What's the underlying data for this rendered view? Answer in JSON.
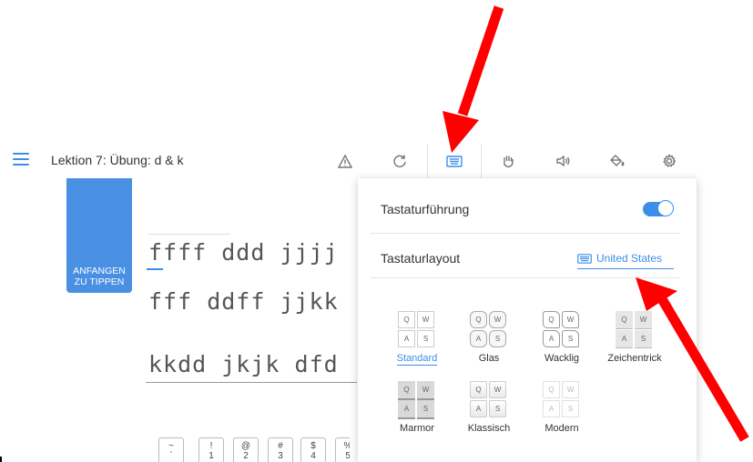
{
  "header": {
    "lesson_title": "Lektion 7: Übung: d & k",
    "tools": [
      {
        "name": "warning-icon"
      },
      {
        "name": "restart-icon"
      },
      {
        "name": "keyboard-icon"
      },
      {
        "name": "hand-icon"
      },
      {
        "name": "sound-icon"
      },
      {
        "name": "paint-bucket-icon"
      },
      {
        "name": "gear-icon"
      }
    ]
  },
  "start_button": {
    "label_line1": "ANFANGEN",
    "label_line2": "ZU TIPPEN"
  },
  "typing": {
    "line1": "ffff ddd jjjj",
    "line2": "fff ddff jjkk",
    "line3": "kkdd jkjk dfd"
  },
  "keyboard": {
    "keys": [
      {
        "top": "~",
        "bottom": "`"
      },
      {
        "top": "!",
        "bottom": "1"
      },
      {
        "top": "@",
        "bottom": "2"
      },
      {
        "top": "#",
        "bottom": "3"
      },
      {
        "top": "$",
        "bottom": "4"
      },
      {
        "top": "%",
        "bottom": "5"
      }
    ]
  },
  "panel": {
    "guidance_label": "Tastaturführung",
    "guidance_enabled": true,
    "layout_label": "Tastaturlayout",
    "layout_value": "United States",
    "styles": [
      {
        "label": "Standard",
        "selected": true
      },
      {
        "label": "Glas",
        "selected": false
      },
      {
        "label": "Wacklig",
        "selected": false
      },
      {
        "label": "Zeichentrick",
        "selected": false
      },
      {
        "label": "Marmor",
        "selected": false
      },
      {
        "label": "Klassisch",
        "selected": false
      },
      {
        "label": "Modern",
        "selected": false
      }
    ],
    "tile_keys": [
      "Q",
      "W",
      "A",
      "S"
    ]
  },
  "colors": {
    "accent": "#3d8ee8",
    "start_button": "#4a90e2",
    "arrow": "#ff0000"
  }
}
